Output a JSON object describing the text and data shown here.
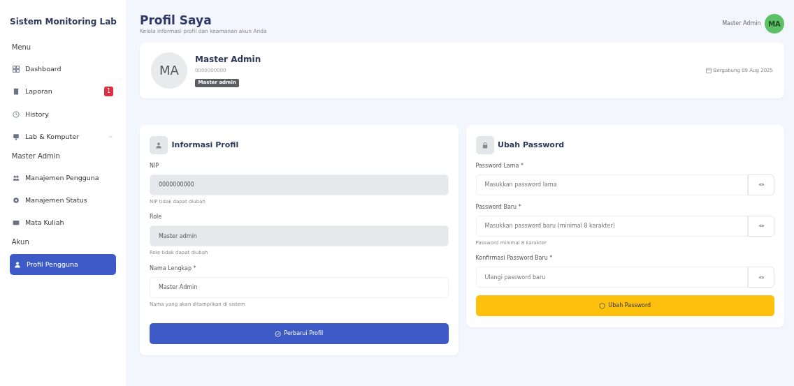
{
  "sidebar": {
    "title": "Sistem Monitoring Lab",
    "sections": [
      {
        "heading": "Menu",
        "items": [
          {
            "label": "Dashboard",
            "selected": false
          },
          {
            "label": "Laporan",
            "badge": "1",
            "selected": false
          },
          {
            "label": "History",
            "selected": false
          },
          {
            "label": "Lab & Komputer",
            "expanded": false,
            "selected": false
          }
        ]
      },
      {
        "heading": "Master Admin",
        "items": [
          {
            "label": "Manajemen Pengguna",
            "selected": false
          },
          {
            "label": "Manajemen Status",
            "selected": false
          },
          {
            "label": "Mata Kuliah",
            "selected": false
          }
        ]
      },
      {
        "heading": "Akun",
        "items": [
          {
            "label": "Profil Pengguna",
            "selected": true
          }
        ]
      }
    ]
  },
  "header": {
    "title": "Profil Saya",
    "subtitle": "Kelola informasi profil dan keamanan akun Anda",
    "user_name": "Master Admin",
    "user_initials": "MA"
  },
  "profile": {
    "initials": "MA",
    "name": "Master Admin",
    "id": "0000000000",
    "role_badge": "Master admin",
    "joined": "Bergabung 09 Aug 2025"
  },
  "profile_form": {
    "title": "Informasi Profil",
    "fields": [
      {
        "label": "NIP",
        "value": "0000000000",
        "help": "NIP tidak dapat diubah",
        "disabled": true
      },
      {
        "label": "Role",
        "value": "Master admin",
        "help": "Role tidak dapat diubah",
        "disabled": true
      },
      {
        "label": "Nama Lengkap *",
        "value": "Master Admin",
        "help": "Nama yang akan ditampilkan di sistem",
        "disabled": false
      }
    ],
    "button": "Perbarui Profil"
  },
  "password_form": {
    "title": "Ubah Password",
    "fields": [
      {
        "label": "Password Lama *",
        "placeholder": "Masukkan password lama"
      },
      {
        "label": "Password Baru *",
        "placeholder": "Masukkan password baru (minimal 8 karakter)",
        "help": "Password minimal 8 karakter"
      },
      {
        "label": "Konfirmasi Password Baru *",
        "placeholder": "Ulangi password baru"
      }
    ],
    "button": "Ubah Password"
  }
}
